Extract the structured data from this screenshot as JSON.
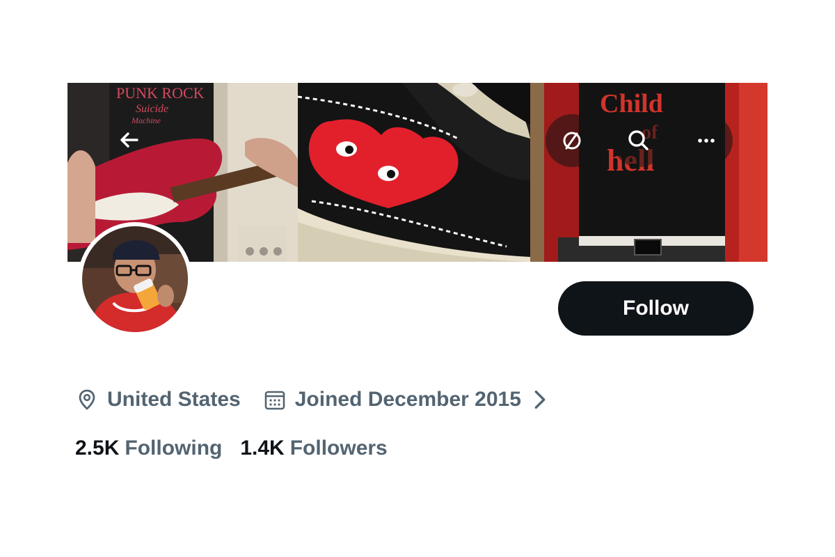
{
  "header": {
    "back_icon": "arrow-left-icon",
    "grok_icon": "grok-icon",
    "search_icon": "search-icon",
    "more_icon": "more-horizontal-icon",
    "banner_text_1": "PUNK ROCK",
    "banner_text_2": "Suicide",
    "banner_text_3": "Machine",
    "banner_text_4": "Child of Hell"
  },
  "profile": {
    "follow_label": "Follow",
    "location": "United States",
    "joined": "Joined December 2015",
    "following_count": "2.5K",
    "following_label": "Following",
    "followers_count": "1.4K",
    "followers_label": "Followers"
  },
  "colors": {
    "primary_text": "#0f1419",
    "secondary_text": "#536471",
    "button_bg": "#0f1419",
    "button_text": "#ffffff"
  }
}
